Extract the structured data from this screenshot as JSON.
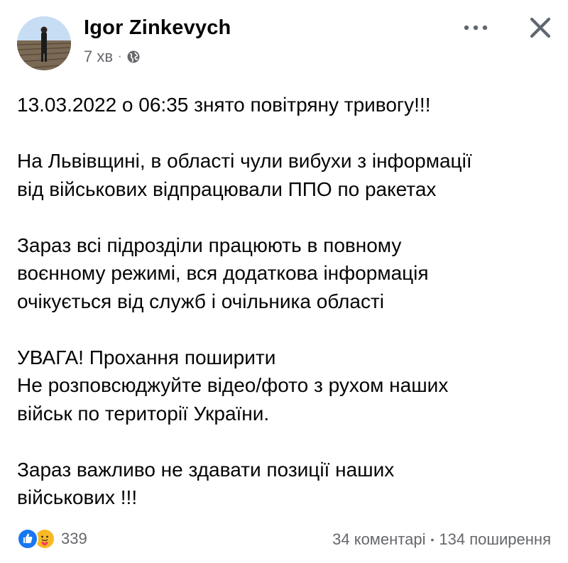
{
  "header": {
    "author": "Igor Zinkevych",
    "time": "7 хв",
    "separator": "·",
    "privacy_icon": "globe-icon",
    "more_icon": "more-horizontal-icon",
    "close_icon": "close-icon"
  },
  "post": {
    "paragraphs": [
      "13.03.2022 о 06:35 знято повітряну тривогу!!!",
      "На Львівщині, в області чули вибухи з інформації\nвід військових відпрацювали ППО по ракетах",
      "Зараз всі підрозділи працюють в повному\nвоєнному режимі, вся додаткова інформація\nочікується від служб і очільника області",
      "УВАГА! Прохання поширити\nНе розповсюджуйте відео/фото з рухом наших\nвійськ по території України.",
      "Зараз важливо не здавати позиції наших\nвійськових !!!"
    ]
  },
  "footer": {
    "reactions_count": "339",
    "reaction_icons": [
      "like-icon",
      "care-icon"
    ],
    "comments": "34 коментарі",
    "separator": "•",
    "shares": "134 поширення"
  },
  "colors": {
    "text": "#050505",
    "secondary": "#65676b",
    "like_blue": "#1877f2",
    "care_yellow": "#f7b928"
  }
}
